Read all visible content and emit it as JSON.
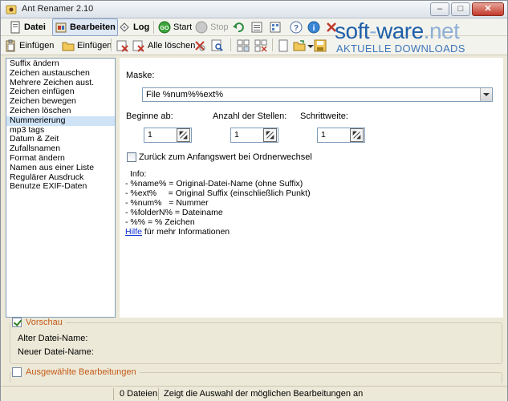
{
  "window": {
    "title": "Ant Renamer 2.10"
  },
  "window_buttons": {
    "minimize": "–",
    "maximize": "□",
    "close": "✕"
  },
  "toolbar1": {
    "file_label": "Datei",
    "edit_label": "Bearbeiten",
    "log_label": "Log",
    "start_label": "Start",
    "stop_label": "Stop"
  },
  "toolbar2": {
    "paste1_label": "Einfügen",
    "paste2_label": "Einfügen",
    "clear_all_label": "Alle löschen"
  },
  "watermark": {
    "main_left": "soft",
    "main_dash": "-",
    "main_mid": "ware",
    "main_dot": ".",
    "main_right": "net",
    "sub": "AKTUELLE DOWNLOADS"
  },
  "action_list": {
    "items": [
      "Suffix ändern",
      "Zeichen austauschen",
      "Mehrere Zeichen aust.",
      "Zeichen einfügen",
      "Zeichen bewegen",
      "Zeichen löschen",
      "Nummerierung",
      "mp3 tags",
      "Datum & Zeit",
      "Zufallsnamen",
      "Format ändern",
      "Namen aus einer Liste",
      "Regulärer Ausdruck",
      "Benutze EXIF-Daten"
    ],
    "selected_index": 6
  },
  "numbering": {
    "mask_label": "Maske:",
    "mask_value": "File %num%%ext%",
    "start_label": "Beginne ab:",
    "start_value": "1",
    "digits_label": "Anzahl der Stellen:",
    "digits_value": "1",
    "step_label": "Schrittweite:",
    "step_value": "1",
    "reset_label": "Zurück zum Anfangswert bei Ordnerwechsel",
    "info_title": "Info:",
    "info_lines": [
      "- %name% = Original-Datei-Name (ohne Suffix)",
      "- %ext%     = Original Suffix (einschließlich Punkt)",
      "- %num%   = Nummer",
      "- %folderN% = Dateiname",
      "- %% = % Zeichen"
    ],
    "help_link": "Hilfe",
    "help_suffix": " für mehr Informationen"
  },
  "preview": {
    "label": "Vorschau",
    "checked": true,
    "old_name_label": "Alter Datei-Name:",
    "new_name_label": "Neuer Datei-Name:"
  },
  "selected_edits": {
    "label": "Ausgewählte Bearbeitungen",
    "checked": false
  },
  "status": {
    "files": "0 Dateien",
    "message": "Zeigt die Auswahl der möglichen Bearbeitungen an"
  },
  "colors": {
    "accent_orange": "#c45a18",
    "selection": "#cfe3f7",
    "link": "#0a2fd1",
    "watermark_blue": "#1f5fa8"
  }
}
